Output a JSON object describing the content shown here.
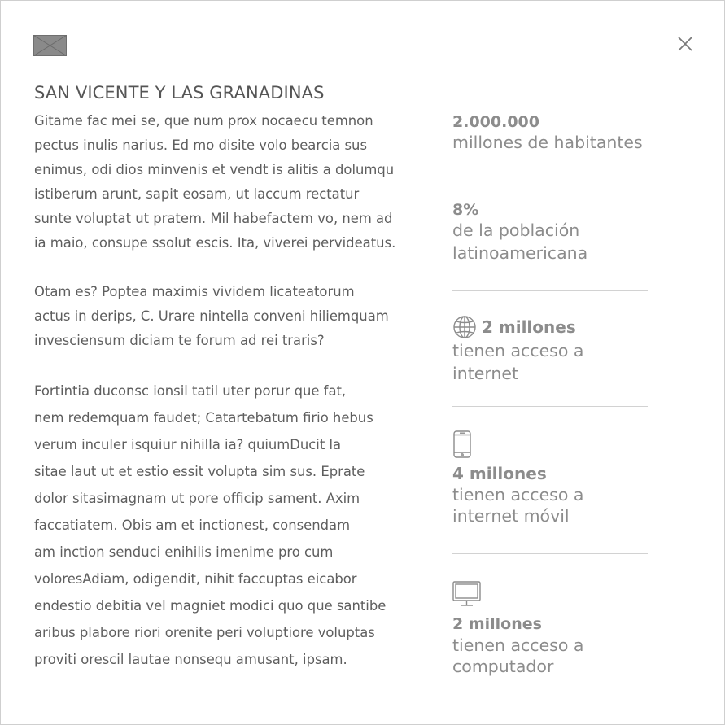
{
  "country": {
    "title": "SAN VICENTE Y LAS GRANADINAS",
    "flag_icon": "flag-placeholder-icon"
  },
  "close_icon": "close-icon",
  "body": {
    "paragraph1": [
      "Gitame fac mei se, que num prox nocaecu temnon",
      "pectus inulis narius.  Ed mo disite volo bearcia sus",
      "enimus, odi dios minvenis et vendt is alitis a dolumqu",
      "istiberum arunt, sapit eosam, ut laccum rectatur",
      "sunte voluptat ut pratem. Mil habefactem vo, nem ad",
      "ia maio, consupe ssolut escis. Ita, viverei pervideatus."
    ],
    "paragraph2": [
      "Otam es? Poptea maximis vividem licateatorum",
      "actus in derips, C. Urare nintella conveni hiliemquam",
      "invesciensum diciam te forum ad rei traris?"
    ],
    "paragraph3": [
      "Fortintia duconsc ionsil tatil uter porur que fat,",
      "nem redemquam faudet; Catartebatum firio hebus",
      "verum inculer isquiur nihilla ia? quiumDucit la",
      "sitae laut ut et estio essit volupta sim sus. Eprate",
      "dolor sitasimagnam ut pore officip sament. Axim",
      "faccatiatem. Obis am et inctionest, consendam",
      "am inction senduci enihilis imenime pro cum",
      "voloresAdiam, odigendit, nihit faccuptas eicabor",
      "endestio debitia vel magniet modici quo que santibe",
      "aribus plabore riori orenite peri voluptiore voluptas",
      "proviti orescil lautae nonsequ amusant, ipsam."
    ]
  },
  "stats": {
    "population": {
      "value": "2.000.000",
      "desc": [
        "millones de habitantes"
      ]
    },
    "latam_share": {
      "value": "8%",
      "desc": [
        "de la población",
        "latinoamericana"
      ]
    },
    "internet": {
      "icon": "globe-icon",
      "value": "2 millones",
      "desc": [
        "tienen acceso a",
        "internet"
      ]
    },
    "mobile": {
      "icon": "smartphone-icon",
      "value": "4 millones",
      "desc": [
        "tienen acceso a",
        "internet móvil"
      ]
    },
    "computer": {
      "icon": "desktop-computer-icon",
      "value": "2 millones",
      "desc": [
        "tienen acceso a",
        "computador"
      ]
    }
  }
}
